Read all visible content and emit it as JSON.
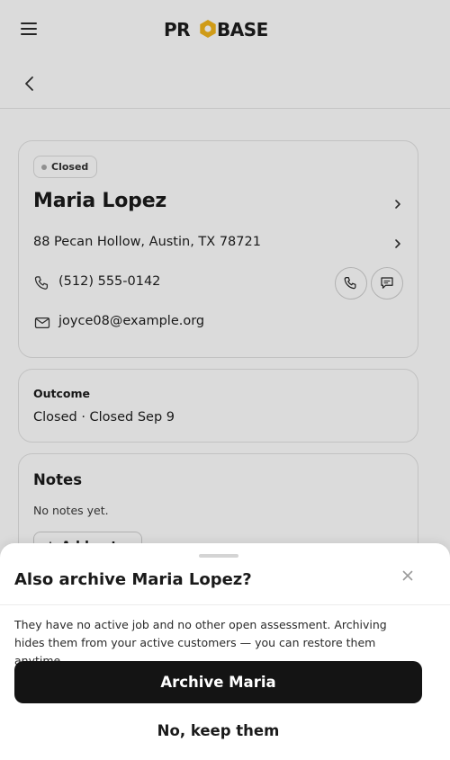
{
  "header": {
    "logo_text": "PROBASE",
    "logo_icon": "hexagon-nut-logo",
    "menu_icon": "hamburger-menu-icon",
    "back_icon": "chevron-left-icon"
  },
  "contact": {
    "status": "Closed",
    "name": "Maria Lopez",
    "address": "88 Pecan Hollow, Austin, TX 78721",
    "phone": "(512) 555-0142",
    "email": "joyce08@example.org"
  },
  "outcome": {
    "label": "Outcome",
    "value": "Closed · Closed Sep 9"
  },
  "notes": {
    "title": "Notes",
    "empty_text": "No notes yet.",
    "add_label": "Add note"
  },
  "sheet": {
    "title": "Also archive Maria Lopez?",
    "body": "They have no active job and no other open assessment. Archiving hides them from your active customers — you can restore them anytime.",
    "primary_label": "Archive Maria",
    "secondary_label": "No, keep them"
  },
  "colors": {
    "logo_accent": "#F2B51C",
    "logo_dark": "#1C1C1C",
    "primary_button": "#141414",
    "status_dot": "#A8A8A8"
  }
}
